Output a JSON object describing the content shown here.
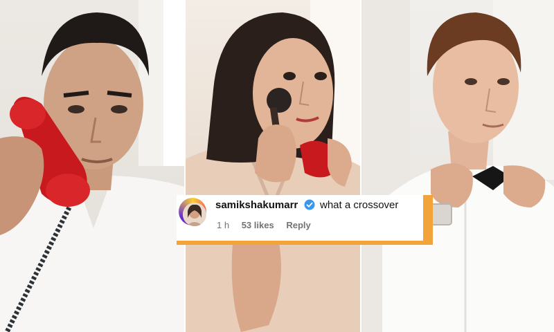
{
  "comment": {
    "username": "samikshakumarr",
    "text": "what a crossover",
    "time": "1 h",
    "likes": "53 likes",
    "reply_label": "Reply"
  },
  "colors": {
    "accent_orange": "#f2a33a",
    "verified_blue": "#3897f0",
    "phone_red": "#c8191e"
  },
  "icons": {
    "verified": "verified-badge-icon",
    "avatar": "user-avatar"
  }
}
